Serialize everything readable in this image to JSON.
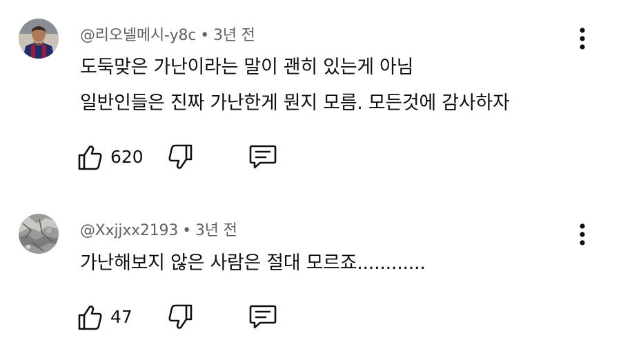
{
  "comments": [
    {
      "author": "@리오넬메시-y8c",
      "separator": "•",
      "time": "3년 전",
      "lines": [
        "도둑맞은 가난이라는 말이 괜히 있는게 아님",
        "일반인들은 진짜 가난한게 뭔지 모름. 모든것에 감사하자"
      ],
      "likes": "620",
      "avatar_icon": "avatar-soccer-player"
    },
    {
      "author": "@Xxjjxx2193",
      "separator": "•",
      "time": "3년 전",
      "lines": [
        "가난해보지 않은 사람은 절대 모르죠............"
      ],
      "likes": "47",
      "avatar_icon": "avatar-rock-texture"
    }
  ],
  "icons": {
    "like": "thumbs-up-icon",
    "dislike": "thumbs-down-icon",
    "reply": "comment-reply-icon",
    "more": "more-vertical-icon"
  },
  "colors": {
    "text": "#0f0f0f",
    "meta": "#606060",
    "background": "#ffffff"
  }
}
